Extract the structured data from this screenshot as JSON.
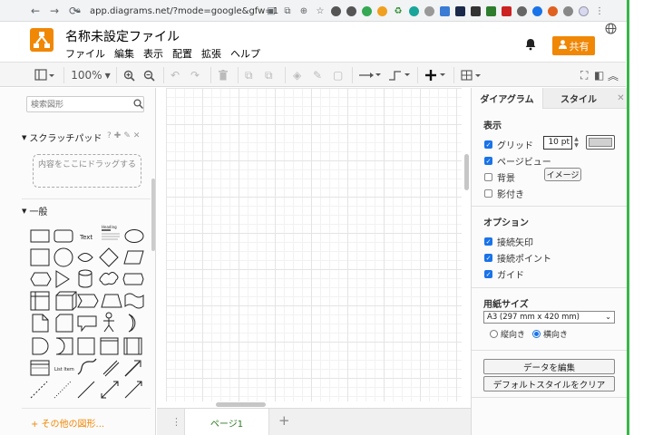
{
  "browser": {
    "url": "app.diagrams.net/?mode=google&gfw=1"
  },
  "app": {
    "title": "名称未設定ファイル",
    "menu": [
      "ファイル",
      "編集",
      "表示",
      "配置",
      "拡張",
      "ヘルプ"
    ],
    "share_label": "共有",
    "accent_color": "#f08705"
  },
  "toolbar": {
    "zoom": "100%"
  },
  "left_panel": {
    "search_placeholder": "検索図形",
    "scratchpad_title": "スクラッチパッド",
    "scratchpad_help": "?",
    "dropzone_text": "内容をここにドラッグする",
    "general_title": "一般",
    "shape_text_label": "Text",
    "shape_heading_label": "Heading",
    "shape_list_label": "List Item",
    "more_shapes": "+ その他の図形..."
  },
  "page_bar": {
    "page_tab": "ページ1"
  },
  "right_panel": {
    "tabs": [
      "ダイアグラム",
      "スタイル"
    ],
    "view_section": "表示",
    "grid_label": "グリッド",
    "grid_checked": true,
    "grid_size": "10 pt",
    "page_view_label": "ページビュー",
    "page_view_checked": true,
    "background_label": "背景",
    "background_checked": false,
    "image_button": "イメージ",
    "shadow_label": "影付き",
    "shadow_checked": false,
    "options_section": "オプション",
    "connection_arrows_label": "接続矢印",
    "connection_points_label": "接続ポイント",
    "guides_label": "ガイド",
    "paper_section": "用紙サイズ",
    "paper_size": "A3 (297 mm x 420 mm)",
    "portrait_label": "縦向き",
    "landscape_label": "横向き",
    "orientation_selected": "landscape",
    "edit_data_button": "データを編集",
    "clear_style_button": "デフォルトスタイルをクリア"
  }
}
